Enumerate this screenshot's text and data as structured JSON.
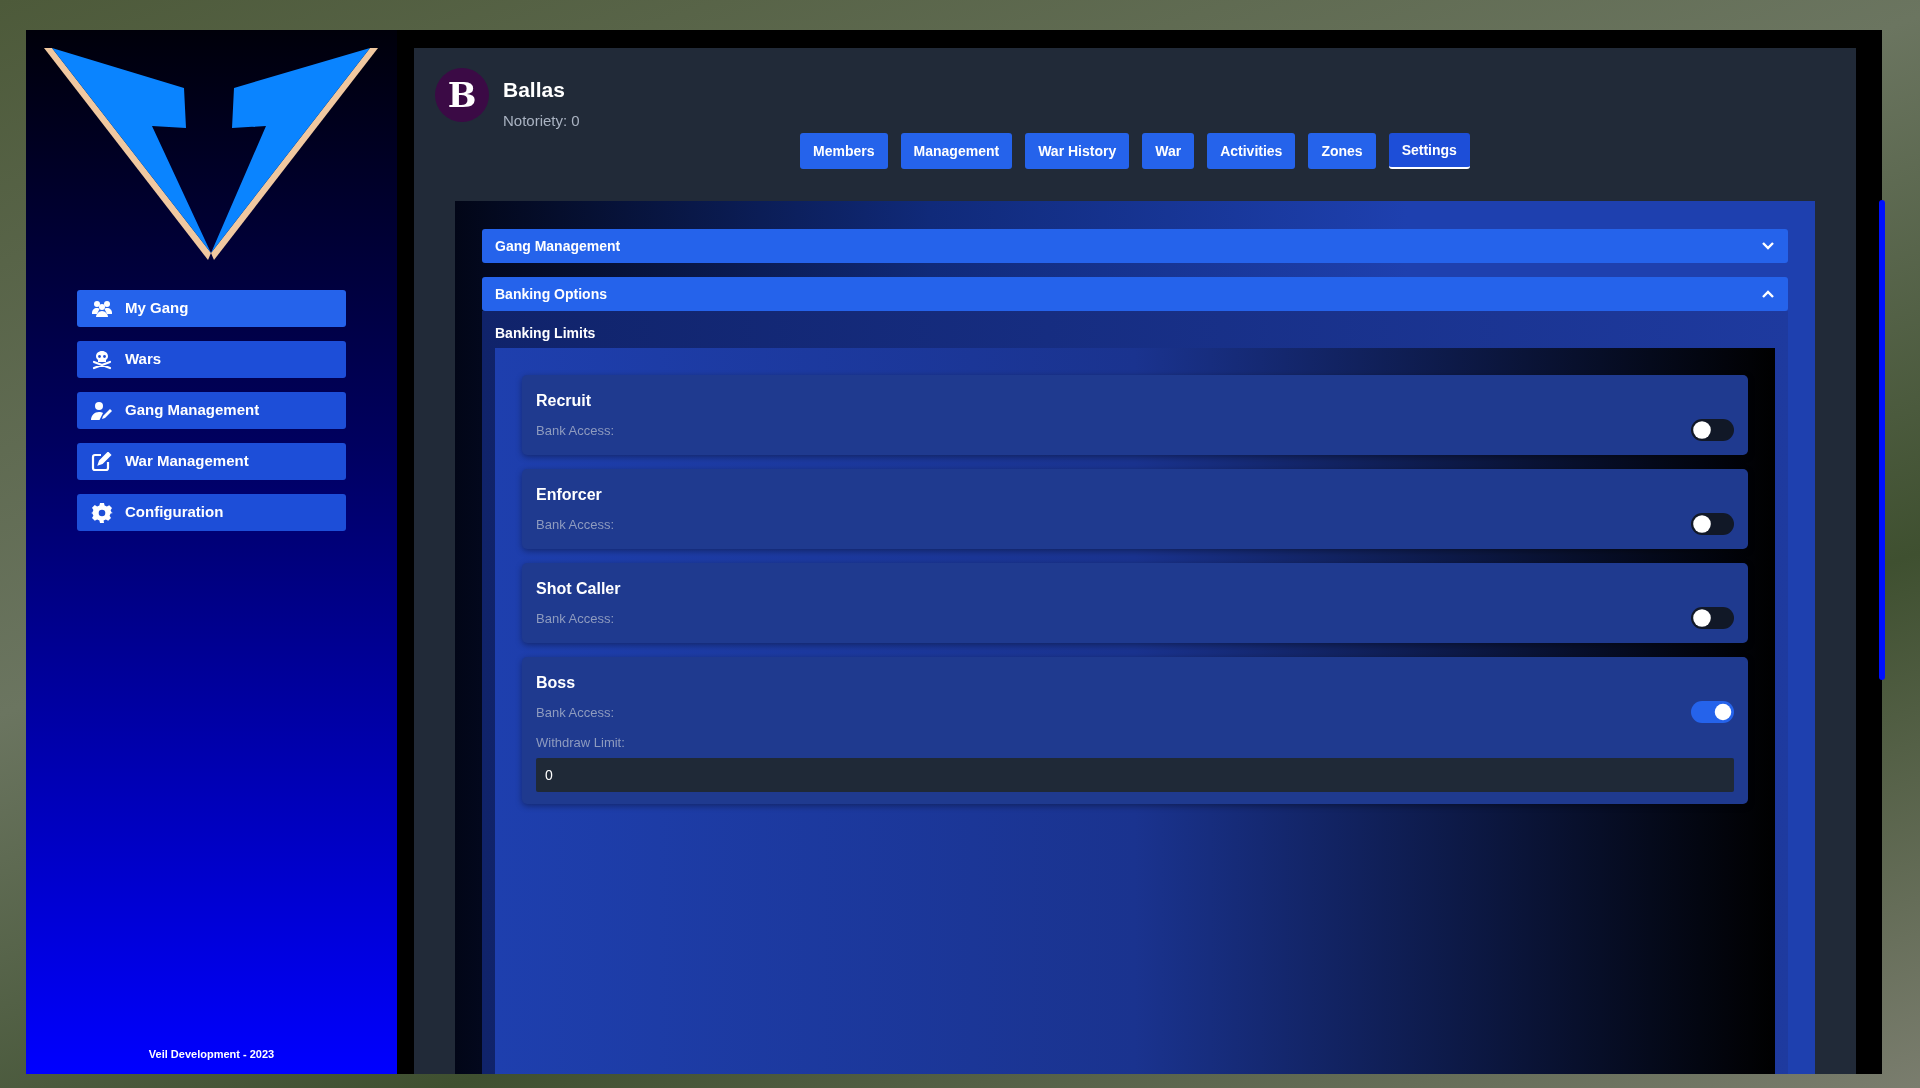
{
  "sidebar": {
    "items": [
      {
        "label": "My Gang",
        "selected": true
      },
      {
        "label": "Wars",
        "selected": false
      },
      {
        "label": "Gang Management",
        "selected": false
      },
      {
        "label": "War Management",
        "selected": false
      },
      {
        "label": "Configuration",
        "selected": false
      }
    ],
    "footer": "Veil Development - 2023"
  },
  "gang": {
    "avatar_letter": "B",
    "name": "Ballas",
    "notoriety": "Notoriety: 0"
  },
  "tabs": [
    {
      "label": "Members",
      "selected": false
    },
    {
      "label": "Management",
      "selected": false
    },
    {
      "label": "War History",
      "selected": false
    },
    {
      "label": "War",
      "selected": false
    },
    {
      "label": "Activities",
      "selected": false
    },
    {
      "label": "Zones",
      "selected": false
    },
    {
      "label": "Settings",
      "selected": true
    }
  ],
  "sections": [
    {
      "title": "Gang Management",
      "expanded": false
    },
    {
      "title": "Banking Options",
      "expanded": true,
      "subtitle": "Banking Limits",
      "roles": [
        {
          "name": "Recruit",
          "bank_access_label": "Bank Access:",
          "bank_access": false
        },
        {
          "name": "Enforcer",
          "bank_access_label": "Bank Access:",
          "bank_access": false
        },
        {
          "name": "Shot Caller",
          "bank_access_label": "Bank Access:",
          "bank_access": false
        },
        {
          "name": "Boss",
          "bank_access_label": "Bank Access:",
          "bank_access": true,
          "withdraw_limit_label": "Withdraw Limit:",
          "withdraw_limit": "0"
        }
      ]
    }
  ]
}
